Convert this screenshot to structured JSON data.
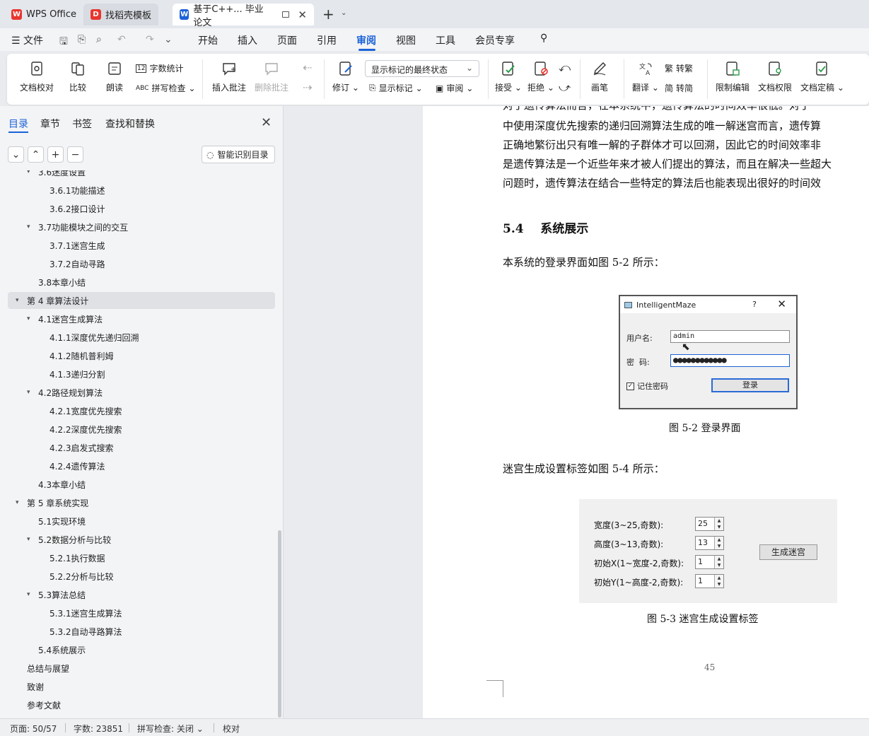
{
  "tabs": [
    {
      "label": "WPS Office",
      "icon": "wps-logo-icon"
    },
    {
      "label": "找稻壳模板",
      "icon": "docer-icon"
    },
    {
      "label": "基于C++... 毕业论文",
      "icon": "word-doc-icon"
    }
  ],
  "menu": {
    "file": "文件",
    "items": [
      "开始",
      "插入",
      "页面",
      "引用",
      "审阅",
      "视图",
      "工具",
      "会员专享"
    ],
    "active": "审阅"
  },
  "ribbon": {
    "doc_proof": "文档校对",
    "compare": "比较",
    "read_aloud": "朗读",
    "word_count": "字数统计",
    "spell_check": "拼写检查",
    "insert_comment": "插入批注",
    "delete_comment": "删除批注",
    "track_changes": "修订",
    "markup_state": "显示标记的最终状态",
    "show_markup": "显示标记",
    "review": "审阅",
    "accept": "接受",
    "reject": "拒绝",
    "pen": "画笔",
    "translate": "翻译",
    "to_traditional": "转繁",
    "to_simplified": "转简",
    "restrict_edit": "限制编辑",
    "doc_permission": "文档权限",
    "doc_finalize": "文档定稿"
  },
  "nav": {
    "tabs": [
      "目录",
      "章节",
      "书签",
      "查找和替换"
    ],
    "smart_toc": "智能识别目录",
    "toc": [
      {
        "label": "3.6迷度设置",
        "level": 2,
        "expanded": true
      },
      {
        "label": "3.6.1功能描述",
        "level": 3
      },
      {
        "label": "3.6.2接口设计",
        "level": 3
      },
      {
        "label": "3.7功能模块之间的交互",
        "level": 2,
        "expanded": true
      },
      {
        "label": "3.7.1迷宫生成",
        "level": 3
      },
      {
        "label": "3.7.2自动寻路",
        "level": 3
      },
      {
        "label": "3.8本章小结",
        "level": 2
      },
      {
        "label": "第 4 章算法设计",
        "level": 1,
        "expanded": true,
        "selected": true
      },
      {
        "label": "4.1迷宫生成算法",
        "level": 2,
        "expanded": true
      },
      {
        "label": "4.1.1深度优先递归回溯",
        "level": 3
      },
      {
        "label": "4.1.2随机普利姆",
        "level": 3
      },
      {
        "label": "4.1.3递归分割",
        "level": 3
      },
      {
        "label": "4.2路径规划算法",
        "level": 2,
        "expanded": true
      },
      {
        "label": "4.2.1宽度优先搜索",
        "level": 3
      },
      {
        "label": "4.2.2深度优先搜索",
        "level": 3
      },
      {
        "label": "4.2.3启发式搜索",
        "level": 3
      },
      {
        "label": "4.2.4遗传算法",
        "level": 3
      },
      {
        "label": "4.3本章小结",
        "level": 2
      },
      {
        "label": "第 5 章系统实现",
        "level": 1,
        "expanded": true
      },
      {
        "label": "5.1实现环境",
        "level": 2
      },
      {
        "label": "5.2数据分析与比较",
        "level": 2,
        "expanded": true
      },
      {
        "label": "5.2.1执行数据",
        "level": 3
      },
      {
        "label": "5.2.2分析与比较",
        "level": 3
      },
      {
        "label": "5.3算法总结",
        "level": 2,
        "expanded": true
      },
      {
        "label": "5.3.1迷宫生成算法",
        "level": 3
      },
      {
        "label": "5.3.2自动寻路算法",
        "level": 3
      },
      {
        "label": "5.4系统展示",
        "level": 2
      },
      {
        "label": "总结与展望",
        "level": 1
      },
      {
        "label": "致谢",
        "level": 1
      },
      {
        "label": "参考文献",
        "level": 1
      }
    ]
  },
  "doc": {
    "lines": [
      "对于遗传算法而言，在本系统中，遗传算法的时间效率很低。对于",
      "中使用深度优先搜索的递归回溯算法生成的唯一解迷宫而言，遗传算",
      "正确地繁衍出只有唯一解的子群体才可以回溯，因此它的时间效率非",
      "是遗传算法是一个近些年来才被人们提出的算法，而且在解决一些超大",
      "问题时，遗传算法在结合一些特定的算法后也能表现出很好的时间效"
    ],
    "heading": "5.4    系统展示",
    "para_login": "本系统的登录界面如图 5-2 所示：",
    "caption_login": "图 5-2  登录界面",
    "para_maze": "迷宫生成设置标签如图 5-4 所示：",
    "caption_maze": "图 5-3  迷宫生成设置标签",
    "page_number": "45"
  },
  "login_window": {
    "title": "IntelligentMaze",
    "help": "?",
    "username_label": "用户名:",
    "username_value": "admin",
    "password_label": "密  码:",
    "password_value": "●●●●●●●●●●●●",
    "remember": "记住密码",
    "login_button": "登录"
  },
  "maze_settings": {
    "rows": [
      {
        "label": "宽度(3~25,奇数):",
        "value": "25"
      },
      {
        "label": "高度(3~13,奇数):",
        "value": "13"
      },
      {
        "label": "初始X(1~宽度-2,奇数):",
        "value": "1"
      },
      {
        "label": "初始Y(1~高度-2,奇数):",
        "value": "1"
      }
    ],
    "generate_button": "生成迷宫"
  },
  "status": {
    "page": "页面: 50/57",
    "words": "字数: 23851",
    "spell": "拼写检查: 关闭",
    "proof": "校对"
  },
  "colors": {
    "accent": "#1c62d8",
    "wps_red": "#e8362e"
  }
}
